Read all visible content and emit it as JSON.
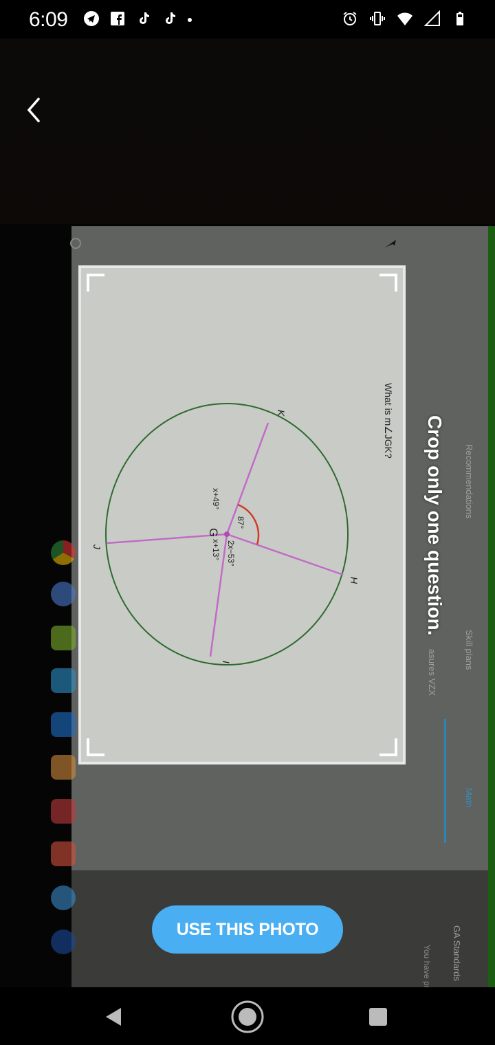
{
  "status_bar": {
    "time": "6:09",
    "left_icons": [
      "telegram-icon",
      "facebook-icon",
      "tiktok-icon",
      "tiktok-icon",
      "more-dot"
    ],
    "right_icons": [
      "alarm-icon",
      "vibrate-icon",
      "wifi-icon",
      "signal-icon",
      "battery-icon"
    ]
  },
  "camera": {
    "hint": "Crop only one question.",
    "use_photo_label": "USE THIS PHOTO",
    "accent_color": "#4aaef2"
  },
  "background_app": {
    "nav_items": [
      "Recommendations",
      "Skill plans",
      "Math",
      "GA Standards"
    ],
    "active_item": "Math",
    "partial_text": "asures  VZX",
    "prize_text": "You have prizes t"
  },
  "question": {
    "prompt": "What is m∠JGK?",
    "center_label": "G",
    "points": [
      "K",
      "H",
      "I",
      "J"
    ],
    "angle_labels": {
      "KGH": "87°",
      "HGI": "2x−53°",
      "IGJ": "x+13°",
      "JGK": "x+49°"
    }
  },
  "dock_apps": [
    "chrome",
    "app-2",
    "app-3",
    "app-4",
    "app-5",
    "app-6",
    "app-7",
    "app-8",
    "app-9",
    "app-10"
  ],
  "nav_bar": {
    "buttons": [
      "back",
      "home",
      "recents"
    ]
  }
}
